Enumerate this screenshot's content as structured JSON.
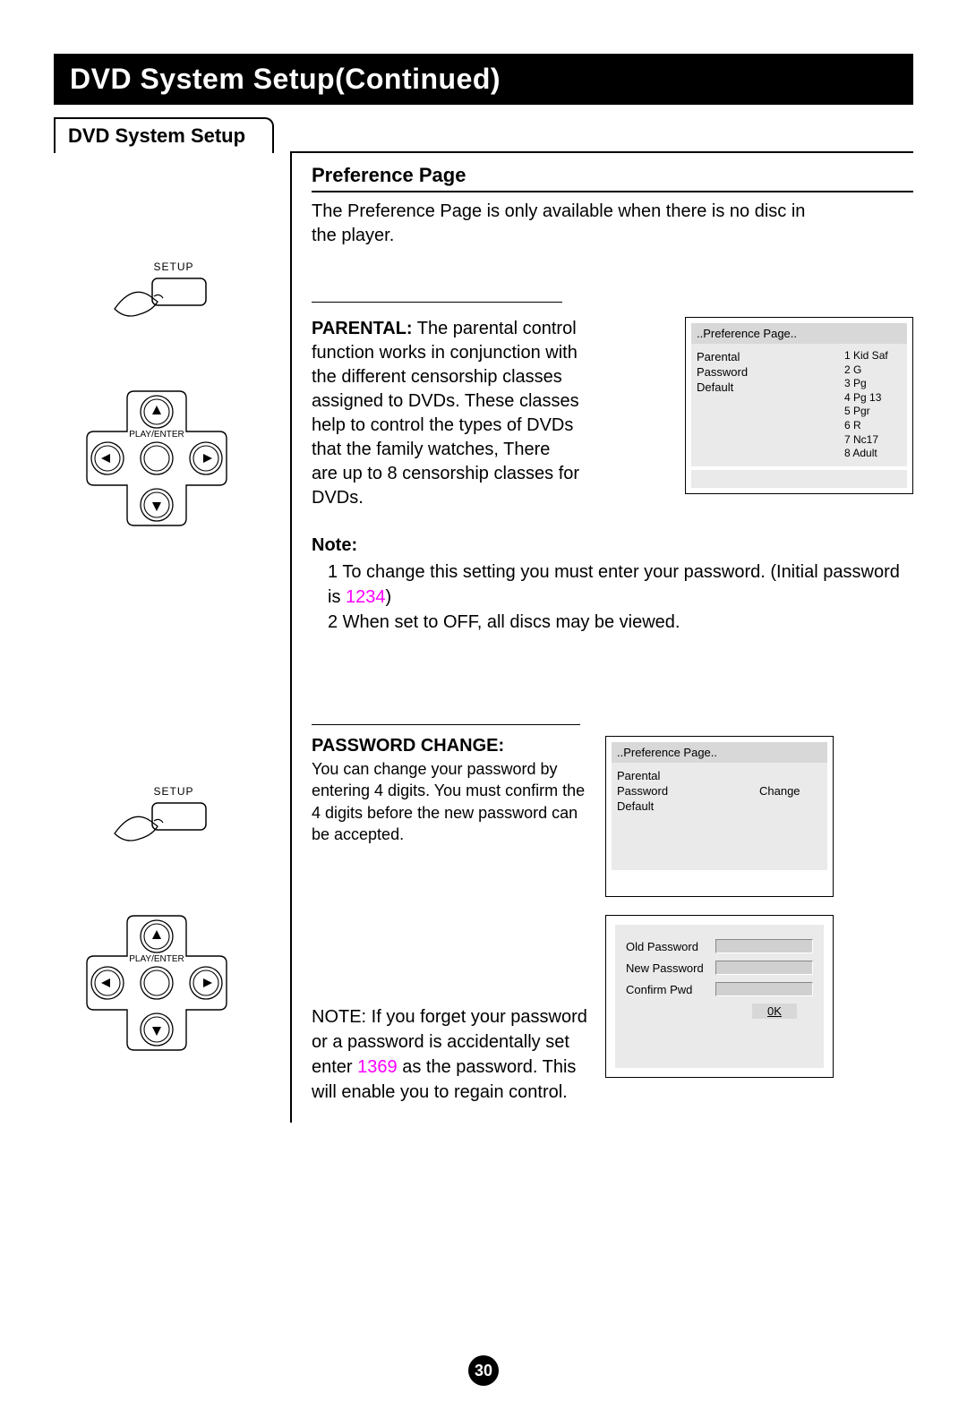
{
  "pageNumber": "30",
  "banner": "DVD System Setup(Continued)",
  "tab": "DVD System Setup",
  "prefTitle": "Preference Page",
  "prefIntro": "The Preference Page is only available when there is no disc in the player.",
  "setupLabel": "SETUP",
  "dpadLabel": "PLAY/ENTER",
  "parental": {
    "head": "PARENTAL:",
    "body": "  The parental control function works in conjunction   with   the different  censorship  classes assigned to DVDs. These classes help to control the types of DVDs that the family watches, There are up to 8 censorship classes for DVDs."
  },
  "osd1": {
    "header": "..Preference Page..",
    "left": [
      "Parental",
      "Password",
      "Default"
    ],
    "right": [
      "1 Kid Saf",
      "2 G",
      "3 Pg",
      "4 Pg 13",
      "5 Pgr",
      "6 R",
      "7 Nc17",
      "8 Adult"
    ]
  },
  "noteHead": "Note:",
  "note1a": "1 To change this setting you must enter your password. (Initial password is ",
  "note1pw": "1234",
  "note1b": ")",
  "note2": "2 When set to OFF, all discs may be viewed.",
  "pwChange": {
    "title": "PASSWORD CHANGE:",
    "body": "You can change your password by entering 4 digits. You must confirm the 4 digits before the new password can be accepted."
  },
  "osd2": {
    "header": "..Preference Page..",
    "left": [
      "Parental",
      "Password",
      "Default"
    ],
    "right": "Change"
  },
  "osd3": {
    "rows": [
      "Old Password",
      "New Password",
      "Confirm Pwd"
    ],
    "ok": "0K"
  },
  "forgetNote": {
    "pre": "NOTE: If you forget your password or a password is accidentally set enter ",
    "code": "1369",
    "post": " as the password. This will enable you to regain control."
  }
}
